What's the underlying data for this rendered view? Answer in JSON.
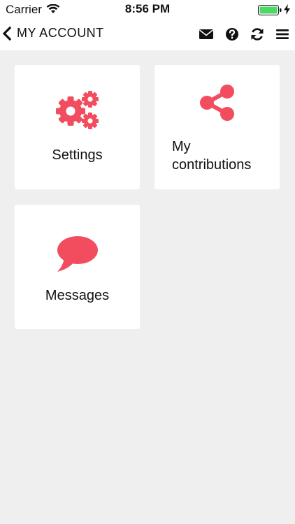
{
  "status_bar": {
    "carrier": "Carrier",
    "time": "8:56 PM",
    "battery_color": "#4cd964"
  },
  "nav": {
    "title": "MY ACCOUNT",
    "back_icon": "chevron-left-icon",
    "actions": [
      "envelope-icon",
      "question-circle-icon",
      "refresh-icon",
      "hamburger-menu-icon"
    ]
  },
  "accent_color": "#f24d5e",
  "tiles": [
    {
      "label": "Settings",
      "icon": "gears-icon"
    },
    {
      "label_line1": "My",
      "label_line2": "contributions",
      "icon": "share-icon"
    },
    {
      "label": "Messages",
      "icon": "speech-bubble-icon"
    }
  ]
}
